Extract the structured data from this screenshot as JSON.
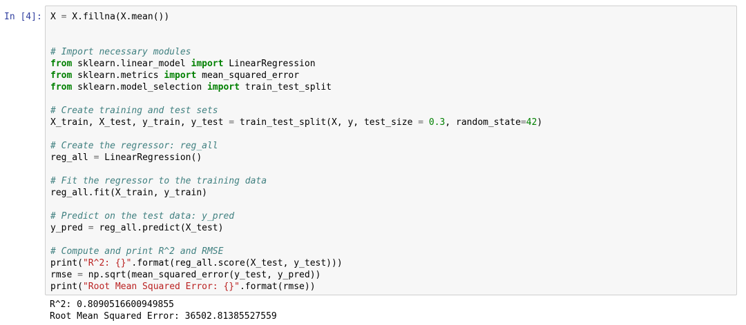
{
  "cell": {
    "prompt": "In [4]:",
    "code": {
      "l1": {
        "a": "X ",
        "op": "=",
        "b": " X.fillna(X.mean())"
      },
      "l4": "# Import necessary modules",
      "l5": {
        "kw1": "from",
        "mod": " sklearn.linear_model ",
        "kw2": "import",
        "name": " LinearRegression"
      },
      "l6": {
        "kw1": "from",
        "mod": " sklearn.metrics ",
        "kw2": "import",
        "name": " mean_squared_error"
      },
      "l7": {
        "kw1": "from",
        "mod": " sklearn.model_selection ",
        "kw2": "import",
        "name": " train_test_split"
      },
      "l9": "# Create training and test sets",
      "l10": {
        "a": "X_train, X_test, y_train, y_test ",
        "op1": "=",
        "b": " train_test_split(X, y, test_size ",
        "op2": "=",
        "c": " ",
        "num1": "0.3",
        "d": ", random_state",
        "op3": "=",
        "num2": "42",
        "e": ")"
      },
      "l12": "# Create the regressor: reg_all",
      "l13": {
        "a": "reg_all ",
        "op": "=",
        "b": " LinearRegression()"
      },
      "l15": "# Fit the regressor to the training data",
      "l16": "reg_all.fit(X_train, y_train)",
      "l18": "# Predict on the test data: y_pred",
      "l19": {
        "a": "y_pred ",
        "op": "=",
        "b": " reg_all.predict(X_test)"
      },
      "l21": "# Compute and print R^2 and RMSE",
      "l22": {
        "a": "print(",
        "str": "\"R^2: {}\"",
        "b": ".format(reg_all.score(X_test, y_test)))"
      },
      "l23": {
        "a": "rmse ",
        "op": "=",
        "b": " np.sqrt(mean_squared_error(y_test, y_pred))"
      },
      "l24": {
        "a": "print(",
        "str": "\"Root Mean Squared Error: {}\"",
        "b": ".format(rmse))"
      }
    },
    "output": {
      "line1": "R^2: 0.8090516600949855",
      "line2": "Root Mean Squared Error: 36502.81385527559"
    }
  },
  "colors": {
    "prompt": "#303f9f",
    "keyword": "#008000",
    "comment": "#408080",
    "string": "#ba2121",
    "number": "#008000",
    "cell_background": "#f7f7f7",
    "cell_border": "#cfcfcf"
  }
}
